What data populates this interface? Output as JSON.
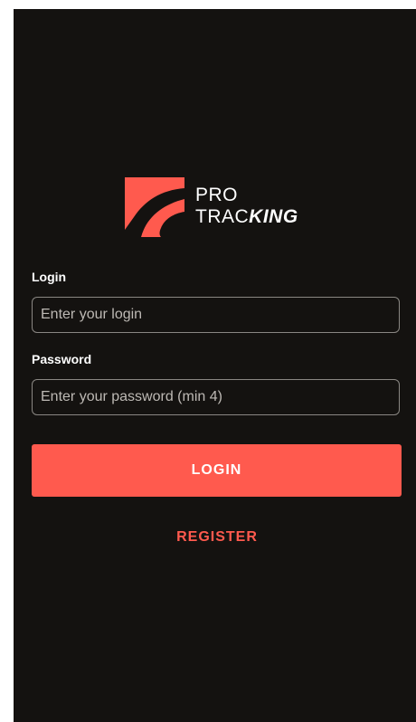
{
  "brand": {
    "line1": "PRO",
    "line2_regular": "TRAC",
    "line2_bold": "KING",
    "icon": "pro-tracking-logo-icon",
    "accent_color": "#ff5a4e"
  },
  "form": {
    "login_label": "Login",
    "login_placeholder": "Enter your login",
    "login_value": "",
    "password_label": "Password",
    "password_placeholder": "Enter your password (min 4)",
    "password_value": ""
  },
  "actions": {
    "login_label": "LOGIN",
    "register_label": "REGISTER"
  },
  "colors": {
    "background": "#141210",
    "accent": "#ff5a4e",
    "text": "#ffffff"
  }
}
